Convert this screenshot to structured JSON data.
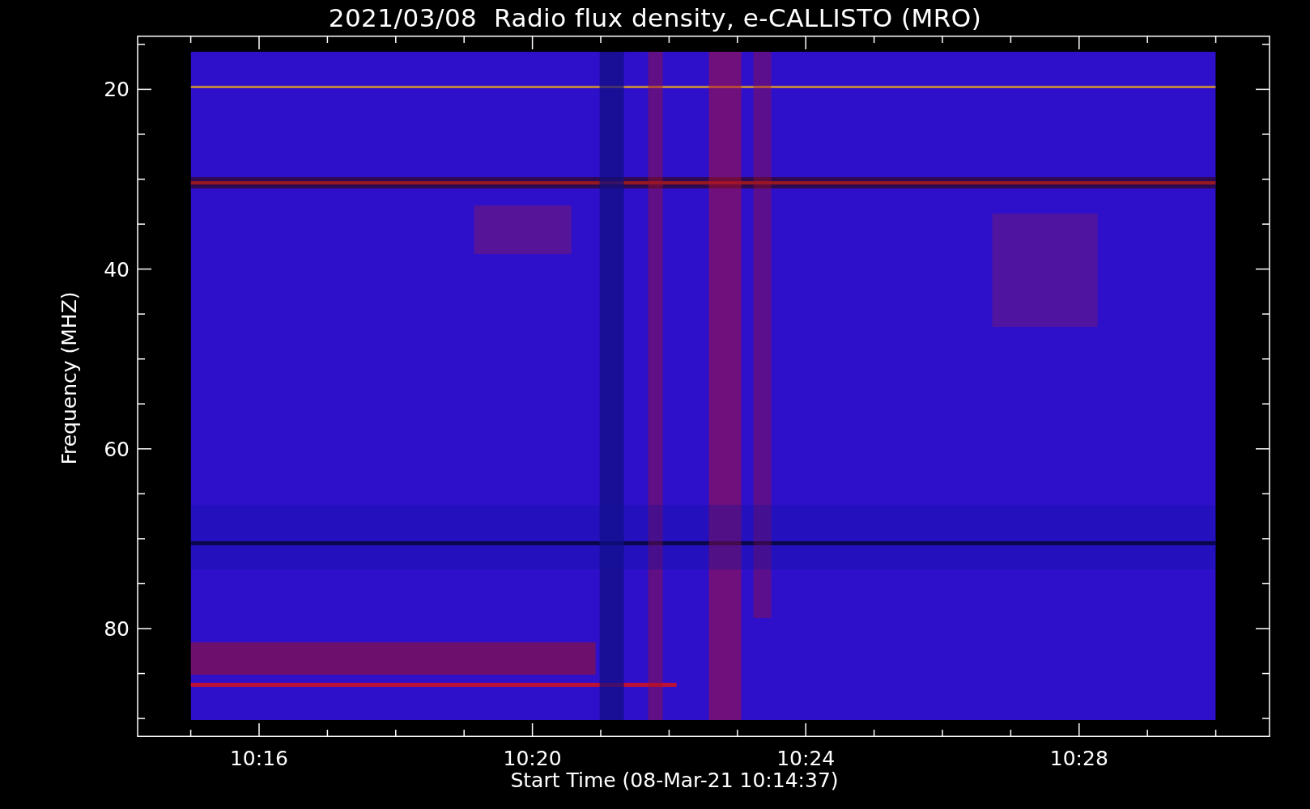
{
  "plot": {
    "title": "2021/03/08  Radio flux density, e-CALLISTO (MRO)",
    "ylabel": "Frequency (MHZ)",
    "xlabel": "Start Time (08-Mar-21 10:14:37)",
    "yticks": [
      "20",
      "40",
      "60",
      "80"
    ],
    "xticks": [
      "10:16",
      "10:20",
      "10:24",
      "10:28"
    ]
  }
}
